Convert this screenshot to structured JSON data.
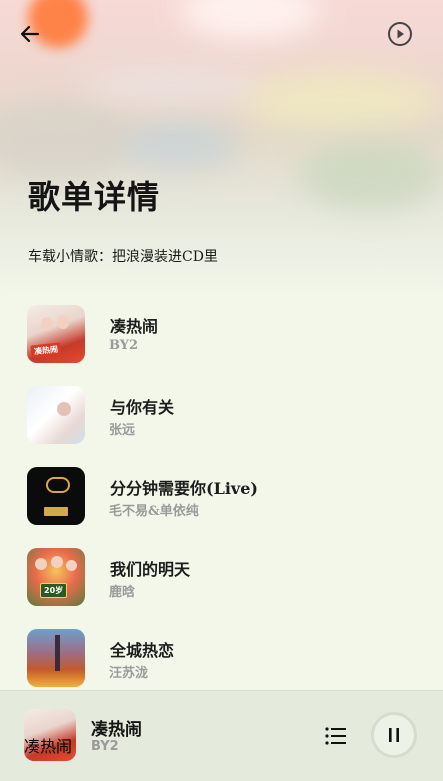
{
  "header": {
    "page_title": "歌单详情",
    "playlist_name": "车载小情歌：把浪漫装进CD里"
  },
  "icons": {
    "back": "arrow-left-icon",
    "play_all": "play-circle-icon",
    "queue": "list-icon",
    "pause": "pause-icon"
  },
  "songs": [
    {
      "title": "凑热闹",
      "artist": "BY2"
    },
    {
      "title": "与你有关",
      "artist": "张远"
    },
    {
      "title": "分分钟需要你(Live)",
      "artist": "毛不易&单依纯"
    },
    {
      "title": "我们的明天",
      "artist": "鹿晗"
    },
    {
      "title": "全城热恋",
      "artist": "汪苏泷"
    }
  ],
  "player": {
    "title": "凑热闹",
    "artist": "BY2"
  },
  "colors": {
    "background": "#f3f7ea",
    "player_bar": "#e4ebdc",
    "text_primary": "#141414",
    "text_secondary": "#9a9a9a"
  }
}
